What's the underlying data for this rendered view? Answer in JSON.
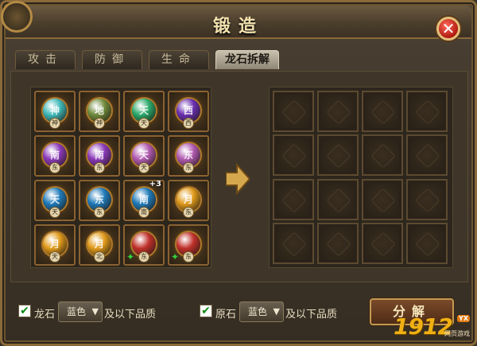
{
  "window": {
    "title": "锻造",
    "close_glyph": "✕"
  },
  "tabs": [
    {
      "label": "攻击",
      "active": false
    },
    {
      "label": "防御",
      "active": false
    },
    {
      "label": "生命",
      "active": false
    },
    {
      "label": "龙石拆解",
      "active": true
    }
  ],
  "inventory": [
    {
      "color": "#3fb8b8",
      "glyph": "神",
      "badge": "神"
    },
    {
      "color": "#6f8a3c",
      "glyph": "地",
      "badge": "神"
    },
    {
      "color": "#2aa86a",
      "glyph": "天",
      "badge": "天"
    },
    {
      "color": "#6a2fb0",
      "glyph": "西",
      "badge": "西"
    },
    {
      "color": "#8a3ab8",
      "glyph": "南",
      "badge": "东"
    },
    {
      "color": "#8a3ab8",
      "glyph": "南",
      "badge": "东"
    },
    {
      "color": "#b05ab0",
      "glyph": "天",
      "badge": "天"
    },
    {
      "color": "#b05ab0",
      "glyph": "东",
      "badge": "东"
    },
    {
      "color": "#1f7ab8",
      "glyph": "天",
      "badge": "天"
    },
    {
      "color": "#1f7ab8",
      "glyph": "东",
      "badge": "东"
    },
    {
      "color": "#1f7ab8",
      "glyph": "南",
      "badge": "南",
      "count": "+3"
    },
    {
      "color": "#e09a1a",
      "glyph": "月",
      "badge": "东"
    },
    {
      "color": "#e09a1a",
      "glyph": "月",
      "badge": "天"
    },
    {
      "color": "#e09a1a",
      "glyph": "月",
      "badge": "北"
    },
    {
      "color": "#c0302a",
      "glyph": "",
      "badge": "东",
      "locked": true
    },
    {
      "color": "#c0302a",
      "glyph": "",
      "badge": "东",
      "locked": true
    }
  ],
  "output_slots": 16,
  "footer": {
    "dragon_stone": {
      "label": "龙石",
      "checked": true,
      "select_value": "蓝色",
      "suffix": "及以下品质"
    },
    "raw_stone": {
      "label": "原石",
      "checked": true,
      "select_value": "蓝色",
      "suffix": "及以下品质"
    },
    "decompose_label": "分解",
    "check_glyph": "✔",
    "select_arrow": "▼"
  },
  "watermark": {
    "digits": "1912",
    "badge": "YX",
    "sub": "网页游戏"
  }
}
